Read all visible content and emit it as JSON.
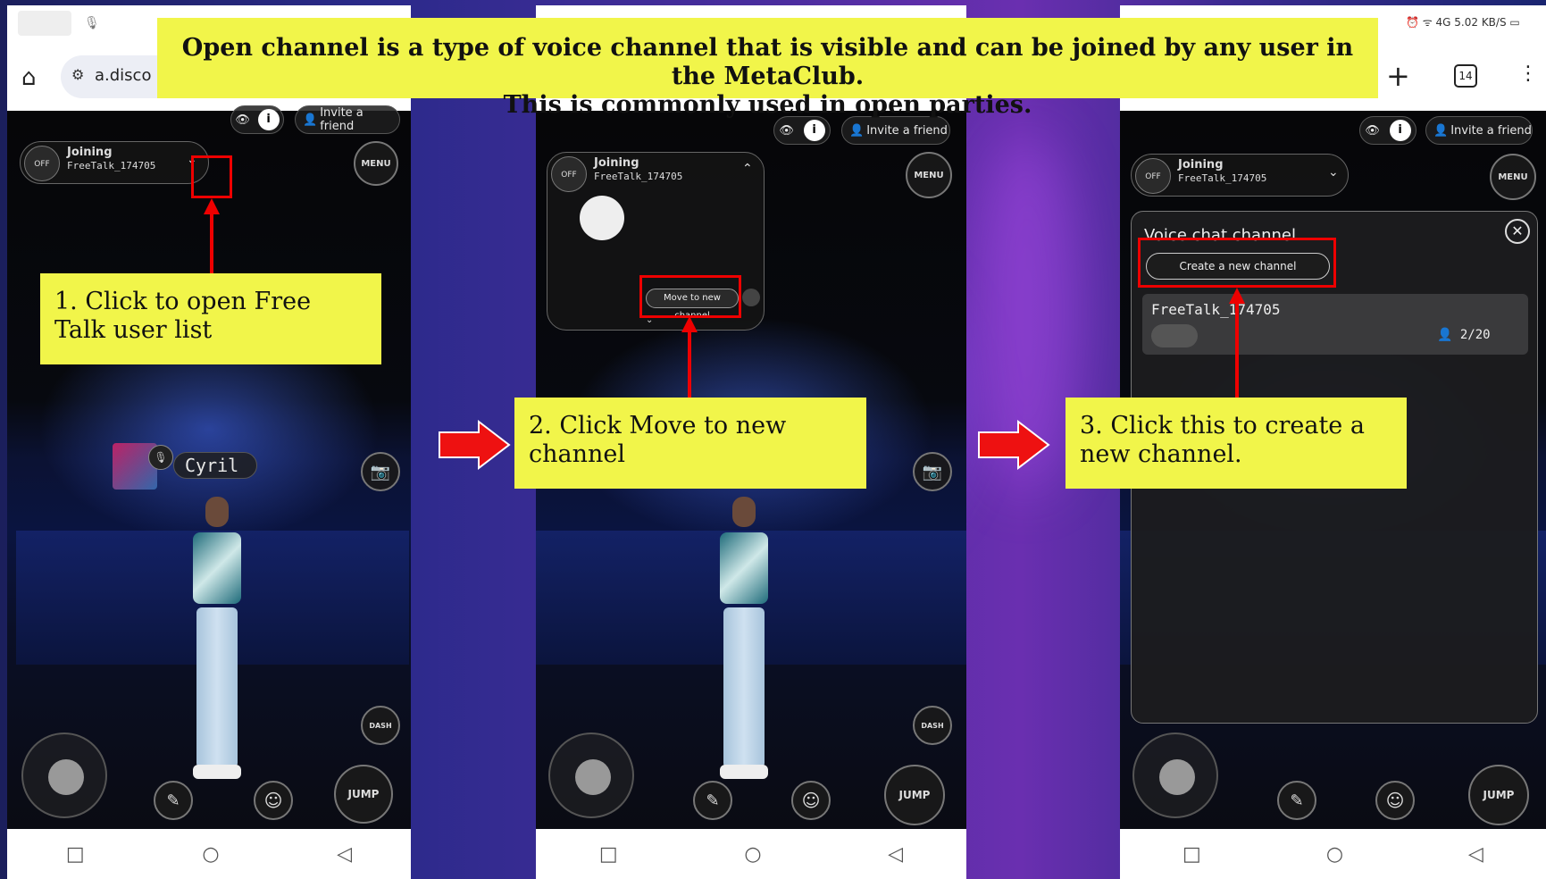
{
  "banner": {
    "line1": "Open channel is a type of voice channel that is visible and can be joined by any user in the MetaClub.",
    "line2": "This is commonly used in open parties."
  },
  "browser": {
    "url_fragment": "a.disco",
    "tab_count": "14",
    "status_icons": "4G 5.02 KB/S"
  },
  "top_controls": {
    "invite_label": "Invite a friend",
    "menu_label": "MENU"
  },
  "voice": {
    "status": "Joining",
    "channel_name": "FreeTalk_174705",
    "mic_state": "OFF"
  },
  "player": {
    "name": "Cyril"
  },
  "controls": {
    "dash_label": "DASH",
    "jump_label": "JUMP"
  },
  "panel2": {
    "move_button": "Move to new channel"
  },
  "panel3": {
    "title": "Voice chat channel",
    "create_button": "Create a new channel",
    "channel_name": "FreeTalk_174705",
    "count": "2/20"
  },
  "steps": {
    "step1": "1. Click to open Free Talk user list",
    "step2": "2. Click Move to new channel",
    "step3": "3. Click this to create a new channel."
  },
  "colors": {
    "highlight": "#f1f54a",
    "annotation_red": "#e00000"
  }
}
